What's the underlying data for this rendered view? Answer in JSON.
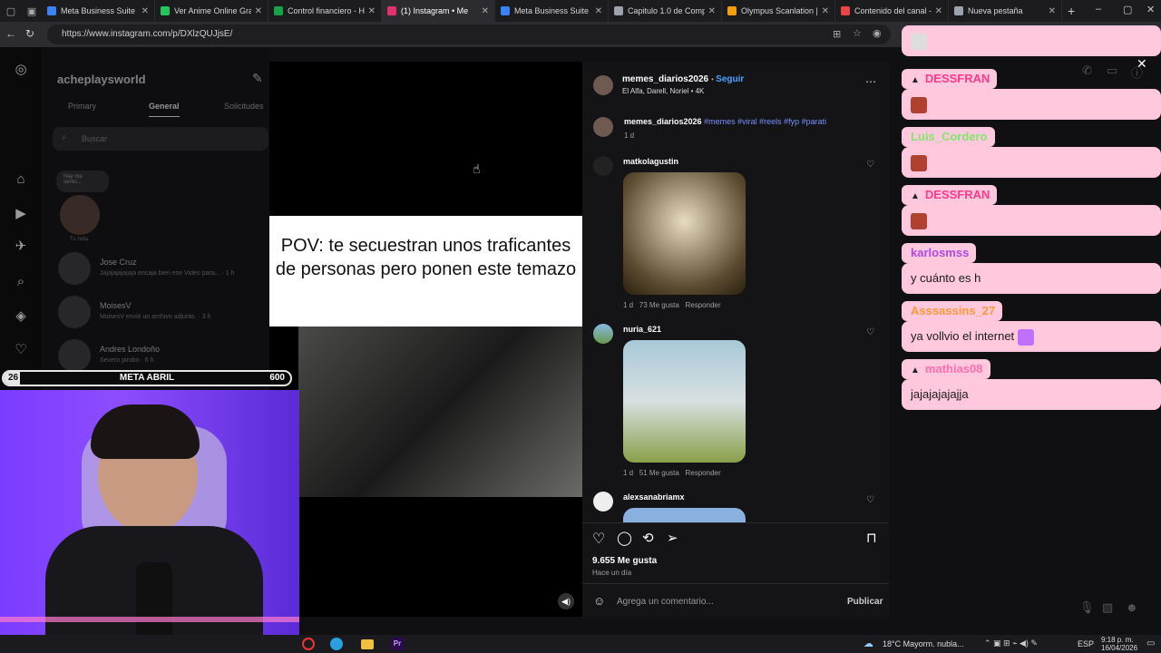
{
  "browser": {
    "tabs": [
      {
        "label": "Meta Business Suite",
        "color": "#3b82f6"
      },
      {
        "label": "Ver Anime Online Gratis",
        "color": "#22c55e"
      },
      {
        "label": "Control financiero - Ho",
        "color": "#16a34a"
      },
      {
        "label": "(1) Instagram • Me",
        "color": "#e1306c"
      },
      {
        "label": "Meta Business Suite",
        "color": "#3b82f6"
      },
      {
        "label": "Capitulo 1.0 de Comple",
        "color": "#9ca3af"
      },
      {
        "label": "Olympus Scanlation | L",
        "color": "#f59e0b"
      },
      {
        "label": "Contenido del canal - Y",
        "color": "#ef4444"
      },
      {
        "label": "Nueva pestaña",
        "color": "#9ca3af"
      }
    ],
    "url": "https://www.instagram.com/p/DXlzQUJjsE/"
  },
  "dm": {
    "username": "acheplaysworld",
    "tabs": [
      "Primary",
      "General",
      "Solicitudes"
    ],
    "search_placeholder": "Buscar",
    "note_label": "Tu nota",
    "note_bubble": "Hay me sento...",
    "threads": [
      {
        "name": "Jose Cruz",
        "sub": "Jajajajajajaja encaja bien ese Video para... · 1 h"
      },
      {
        "name": "MoisesV",
        "sub": "MoisesV envió un archivo adjunto. · 3 h"
      },
      {
        "name": "Andres Londoño",
        "sub": "Severo pirobo · 6 h"
      }
    ]
  },
  "video": {
    "caption": "POV: te secuestran unos traficantes de personas pero ponen este temazo"
  },
  "post": {
    "author": "memes_diarios2026",
    "follow": "Seguir",
    "audio": "El Alfa, Darell, Noriel • 4K",
    "desc_user": "memes_diarios2026",
    "hashtags": "#memes #viral #reels #fyp #parati",
    "desc_time": "1 d",
    "comments": [
      {
        "user": "matkolagustin",
        "time": "1 d",
        "likes": "73 Me gusta",
        "reply": "Responder"
      },
      {
        "user": "nuria_621",
        "time": "1 d",
        "likes": "51 Me gusta",
        "reply": "Responder"
      },
      {
        "user": "alexsanabriamx"
      }
    ],
    "likes": "9.655 Me gusta",
    "posted": "Hace un día",
    "comment_placeholder": "Agrega un comentario...",
    "publish": "Publicar"
  },
  "chat": {
    "messages": [
      {
        "user": "DESSFRAN",
        "text": "",
        "user_color": "#ff3a8c"
      },
      {
        "user": "Luis_Cordero",
        "text": "",
        "user_color": "#7ee86c"
      },
      {
        "user": "DESSFRAN",
        "text": "",
        "user_color": "#ff3a8c"
      },
      {
        "user": "karlosmss",
        "text": "y cuánto es h",
        "user_color": "#b04ae0"
      },
      {
        "user": "Asssassins_27",
        "text": "ya vollvio el internet",
        "user_color": "#ff9a3a"
      },
      {
        "user": "mathias08",
        "text": "jajajajajajja",
        "user_color": "#ff6fb0"
      }
    ]
  },
  "stream": {
    "goal_left": "26",
    "goal_title": "META ABRIL",
    "goal_right": "600",
    "goal_progress": 0.043
  },
  "taskbar": {
    "weather": "18°C  Mayorm. nubla...",
    "lang": "ESP",
    "time": "9:18 p. m.",
    "date": "16/04/2026"
  }
}
